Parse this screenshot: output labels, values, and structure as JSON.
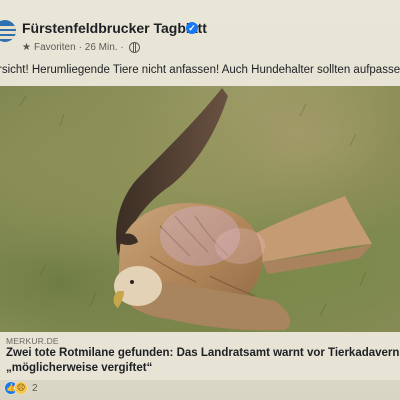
{
  "post": {
    "page_name": "Fürstenfeldbrucker Tagblatt",
    "meta_audience": "Favoriten",
    "meta_time": "· 26 Min. ·",
    "text": "rsicht! Herumliegende Tiere nicht anfassen! Auch Hundehalter sollten aufpassen!"
  },
  "link": {
    "domain": "MERKUR.DE",
    "headline_line1": "Zwei tote Rotmilane gefunden: Das Landratsamt warnt vor Tierkadavern -",
    "headline_line2": "„möglicherweise vergiftet“"
  },
  "reactions": {
    "count": "2",
    "icons": [
      "like-reaction-icon",
      "sad-reaction-icon"
    ]
  },
  "icons": {
    "verified": "verified-badge-icon",
    "favorites": "star-icon",
    "audience": "globe-icon"
  },
  "colors": {
    "verified": "#1877f2",
    "like": "#1877f2",
    "sad": "#f7c64a"
  }
}
